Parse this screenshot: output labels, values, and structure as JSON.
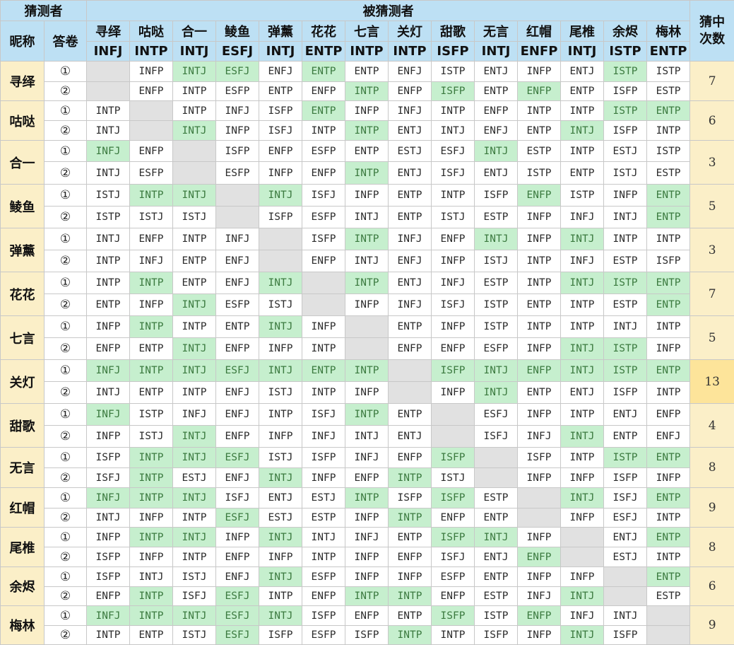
{
  "headers": {
    "guesser": "猜测者",
    "guessed": "被猜测者",
    "nickname": "昵称",
    "answer_sheet": "答卷",
    "hit_count": "猜中次数"
  },
  "people": [
    {
      "name": "寻绎",
      "mbti": "INFJ"
    },
    {
      "name": "咕哒",
      "mbti": "INTP"
    },
    {
      "name": "合一",
      "mbti": "INTJ"
    },
    {
      "name": "鲮鱼",
      "mbti": "ESFJ"
    },
    {
      "name": "弹薰",
      "mbti": "INTJ"
    },
    {
      "name": "花花",
      "mbti": "ENTP"
    },
    {
      "name": "七言",
      "mbti": "INTP"
    },
    {
      "name": "关灯",
      "mbti": "INTP"
    },
    {
      "name": "甜歌",
      "mbti": "ISFP"
    },
    {
      "name": "无言",
      "mbti": "INTJ"
    },
    {
      "name": "红帽",
      "mbti": "ENFP"
    },
    {
      "name": "尾椎",
      "mbti": "INTJ"
    },
    {
      "name": "余烬",
      "mbti": "ISTP"
    },
    {
      "name": "梅林",
      "mbti": "ENTP"
    }
  ],
  "sheet_labels": [
    "①",
    "②"
  ],
  "rows": [
    {
      "name": "寻绎",
      "hits": "7",
      "answers": [
        [
          "",
          "INFP",
          "INTJ",
          "ESFJ",
          "ENFJ",
          "ENTP",
          "ENTP",
          "ENFJ",
          "ISTP",
          "ENTJ",
          "INFP",
          "ENTJ",
          "ISTP",
          "ISTP"
        ],
        [
          "",
          "ENFP",
          "INTP",
          "ESFP",
          "ENTP",
          "ENFP",
          "INTP",
          "ENFP",
          "ISFP",
          "ENTP",
          "ENFP",
          "ENTP",
          "ISFP",
          "ESTP"
        ]
      ]
    },
    {
      "name": "咕哒",
      "hits": "6",
      "answers": [
        [
          "INTP",
          "",
          "INTP",
          "INFJ",
          "ISFP",
          "ENTP",
          "INFP",
          "INFJ",
          "INTP",
          "ENFP",
          "INTP",
          "INTP",
          "ISTP",
          "ENTP"
        ],
        [
          "INTJ",
          "",
          "INTJ",
          "INFP",
          "ISFJ",
          "INTP",
          "INTP",
          "ENTJ",
          "INTJ",
          "ENFJ",
          "ENTP",
          "INTJ",
          "ISFP",
          "INTP"
        ]
      ]
    },
    {
      "name": "合一",
      "hits": "3",
      "answers": [
        [
          "INFJ",
          "ENFP",
          "",
          "ISFP",
          "ENFP",
          "ESFP",
          "ENTP",
          "ESTJ",
          "ESFJ",
          "INTJ",
          "ESTP",
          "INTP",
          "ESTJ",
          "ISTP"
        ],
        [
          "INTJ",
          "ESFP",
          "",
          "ESFP",
          "INFP",
          "ENFP",
          "INTP",
          "ENTJ",
          "ISFJ",
          "ENTJ",
          "ISTP",
          "ENTP",
          "ISTJ",
          "ESTP"
        ]
      ]
    },
    {
      "name": "鲮鱼",
      "hits": "5",
      "answers": [
        [
          "ISTJ",
          "INTP",
          "INTJ",
          "",
          "INTJ",
          "ISFJ",
          "INFP",
          "ENTP",
          "INTP",
          "ISFP",
          "ENFP",
          "ISTP",
          "INFP",
          "ENTP"
        ],
        [
          "ISTP",
          "ISTJ",
          "ISTJ",
          "",
          "ISFP",
          "ESFP",
          "INTJ",
          "ENTP",
          "ISTJ",
          "ESTP",
          "INFP",
          "INFJ",
          "INTJ",
          "ENTP"
        ]
      ]
    },
    {
      "name": "弹薰",
      "hits": "3",
      "answers": [
        [
          "INTJ",
          "ENFP",
          "INTP",
          "INFJ",
          "",
          "ISFP",
          "INTP",
          "INFJ",
          "ENFP",
          "INTJ",
          "INFP",
          "INTJ",
          "INTP",
          "INTP"
        ],
        [
          "INTP",
          "INFJ",
          "ENTP",
          "ENFJ",
          "",
          "ENFP",
          "INTJ",
          "ENFJ",
          "INFP",
          "ISTJ",
          "INTP",
          "INFJ",
          "ESTP",
          "ISFP"
        ]
      ]
    },
    {
      "name": "花花",
      "hits": "7",
      "answers": [
        [
          "INTP",
          "INTP",
          "ENTP",
          "ENFJ",
          "INTJ",
          "",
          "INTP",
          "ENTJ",
          "INFJ",
          "ESTP",
          "INTP",
          "INTJ",
          "ISTP",
          "ENTP"
        ],
        [
          "ENTP",
          "INFP",
          "INTJ",
          "ESFP",
          "ISTJ",
          "",
          "INFP",
          "INFJ",
          "ISFJ",
          "ISTP",
          "ENTP",
          "INTP",
          "ESTP",
          "ENTP"
        ]
      ]
    },
    {
      "name": "七言",
      "hits": "5",
      "answers": [
        [
          "INFP",
          "INTP",
          "INTP",
          "ENTP",
          "INTJ",
          "INFP",
          "",
          "ENTP",
          "INFP",
          "ISTP",
          "INTP",
          "INTP",
          "INTJ",
          "INTP"
        ],
        [
          "ENFP",
          "ENTP",
          "INTJ",
          "ENFP",
          "INFP",
          "INTP",
          "",
          "ENFP",
          "ENFP",
          "ESFP",
          "INFP",
          "INTJ",
          "ISTP",
          "INFP"
        ]
      ]
    },
    {
      "name": "关灯",
      "hits": "13",
      "answers": [
        [
          "INFJ",
          "INTP",
          "INTJ",
          "ESFJ",
          "INTJ",
          "ENTP",
          "INTP",
          "",
          "ISFP",
          "INTJ",
          "ENFP",
          "INTJ",
          "ISTP",
          "ENTP"
        ],
        [
          "INTJ",
          "ENTP",
          "INTP",
          "ENFJ",
          "ISTJ",
          "INTP",
          "INFP",
          "",
          "INFP",
          "INTJ",
          "ENTP",
          "ENTJ",
          "ISFP",
          "INTP"
        ]
      ]
    },
    {
      "name": "甜歌",
      "hits": "4",
      "answers": [
        [
          "INFJ",
          "ISTP",
          "INFJ",
          "ENFJ",
          "INTP",
          "ISFJ",
          "INTP",
          "ENTP",
          "",
          "ESFJ",
          "INFP",
          "INTP",
          "ENTJ",
          "ENFP"
        ],
        [
          "INFP",
          "ISTJ",
          "INTJ",
          "ENFP",
          "INFP",
          "INFJ",
          "INTJ",
          "ENTJ",
          "",
          "ISFJ",
          "INFJ",
          "INTJ",
          "ENTP",
          "ENFJ"
        ]
      ]
    },
    {
      "name": "无言",
      "hits": "8",
      "answers": [
        [
          "ISFP",
          "INTP",
          "INTJ",
          "ESFJ",
          "ISTJ",
          "ISFP",
          "INFJ",
          "ENFP",
          "ISFP",
          "",
          "ISFP",
          "INTP",
          "ISTP",
          "ENTP"
        ],
        [
          "ISFJ",
          "INTP",
          "ESTJ",
          "ENFJ",
          "INTJ",
          "INFP",
          "ENFP",
          "INTP",
          "ISTJ",
          "",
          "INFP",
          "INFP",
          "ISFP",
          "INFP"
        ]
      ]
    },
    {
      "name": "红帽",
      "hits": "9",
      "answers": [
        [
          "INFJ",
          "INTP",
          "INTJ",
          "ISFJ",
          "ENTJ",
          "ESTJ",
          "INTP",
          "ISFP",
          "ISFP",
          "ESTP",
          "",
          "INTJ",
          "ISFJ",
          "ENTP"
        ],
        [
          "INTJ",
          "INFP",
          "INTP",
          "ESFJ",
          "ESTJ",
          "ESTP",
          "INFP",
          "INTP",
          "ENFP",
          "ENTP",
          "",
          "INFP",
          "ESFJ",
          "INTP"
        ]
      ]
    },
    {
      "name": "尾椎",
      "hits": "8",
      "answers": [
        [
          "INFP",
          "INTP",
          "INTJ",
          "INFP",
          "INTJ",
          "INTJ",
          "INFJ",
          "ENTP",
          "ISFP",
          "INTJ",
          "INFP",
          "",
          "ENTJ",
          "ENTP"
        ],
        [
          "ISFP",
          "INFP",
          "INTP",
          "ENFP",
          "INFP",
          "INTP",
          "INFP",
          "ENFP",
          "ISFJ",
          "ENTJ",
          "ENFP",
          "",
          "ESTJ",
          "INTP"
        ]
      ]
    },
    {
      "name": "余烬",
      "hits": "6",
      "answers": [
        [
          "ISFP",
          "INTJ",
          "ISTJ",
          "ENFJ",
          "INTJ",
          "ESFP",
          "INFP",
          "INFP",
          "ESFP",
          "ENTP",
          "INFP",
          "INFP",
          "",
          "ENTP"
        ],
        [
          "ENFP",
          "INTP",
          "ISFJ",
          "ESFJ",
          "INTP",
          "ENFP",
          "INTP",
          "INTP",
          "ENFP",
          "ESTP",
          "INFJ",
          "INTJ",
          "",
          "ESTP"
        ]
      ]
    },
    {
      "name": "梅林",
      "hits": "9",
      "answers": [
        [
          "INFJ",
          "INTP",
          "INTJ",
          "ESFJ",
          "INTJ",
          "ISFP",
          "ENFP",
          "ENTP",
          "ISFP",
          "ISTP",
          "ENFP",
          "INFJ",
          "INTJ",
          ""
        ],
        [
          "INTP",
          "ENTP",
          "ISTJ",
          "ESFJ",
          "ISFP",
          "ESFP",
          "ISFP",
          "INTP",
          "INTP",
          "ISFP",
          "INFP",
          "INTJ",
          "ISFP",
          ""
        ]
      ]
    }
  ],
  "colors": {
    "header_bg": "#bde0f4",
    "name_bg": "#fbefc8",
    "hit_bg": "#c6efce",
    "hit_text": "#3b7a3f",
    "self_bg": "#e1e1e1",
    "best_bg": "#fde49a"
  }
}
